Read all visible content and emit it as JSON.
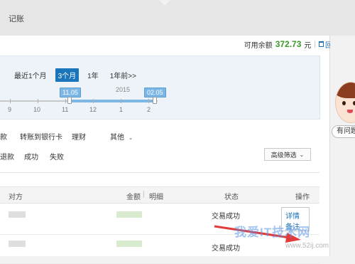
{
  "header": {
    "tab_label": "记账"
  },
  "balance": {
    "label": "可用余额",
    "amount": "372.73",
    "unit": "元",
    "separator": "|",
    "recycle_label": "回收站"
  },
  "range_tabs": [
    {
      "label": "最近1个月",
      "active": false
    },
    {
      "label": "3个月",
      "active": true
    },
    {
      "label": "1年",
      "active": false
    },
    {
      "label": "1年前>>",
      "active": false
    }
  ],
  "timeline": {
    "year": "2015",
    "ticks": [
      "9",
      "10",
      "11",
      "12",
      "1",
      "2"
    ],
    "start_handle": "11.05",
    "end_handle": "02.05"
  },
  "type_filters": {
    "partial_first": "款",
    "bank_transfer": "转账到银行卡",
    "wealth": "理财",
    "other": "其他"
  },
  "status_filters": {
    "refund": "退款",
    "success": "成功",
    "failed": "失败",
    "advanced": "高级筛选"
  },
  "table": {
    "headers": {
      "counterparty": "对方",
      "amount": "金额",
      "separator": "|",
      "detail": "明细",
      "status": "状态",
      "action": "操作"
    },
    "rows": [
      {
        "status": "交易成功",
        "detail_link": "详情",
        "note_link": "备注"
      },
      {
        "status": "交易成功",
        "detail_link": "",
        "note_link": ""
      }
    ]
  },
  "help": {
    "label": "有问题"
  },
  "watermark": {
    "text": "我爱IT技术网",
    "url": "www.52ij.com"
  }
}
